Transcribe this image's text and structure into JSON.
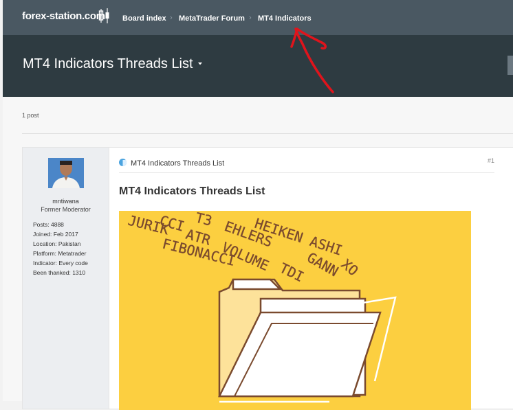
{
  "nav": {
    "logo_text": "forex-station.com",
    "breadcrumbs": [
      "Board index",
      "MetaTrader Forum",
      "MT4 Indicators"
    ]
  },
  "header": {
    "title": "MT4 Indicators Threads List"
  },
  "topic": {
    "post_count": "1 post"
  },
  "post": {
    "author": {
      "username": "mntiwana",
      "rank": "Former Moderator",
      "stats": [
        {
          "label": "Posts:",
          "value": "4888"
        },
        {
          "label": "Joined:",
          "value": "Feb 2017"
        },
        {
          "label": "Location:",
          "value": "Pakistan"
        },
        {
          "label": "Platform:",
          "value": "Metatrader"
        },
        {
          "label": "Indicator:",
          "value": "Every code"
        },
        {
          "label": "Been thanked:",
          "value": "1310"
        }
      ]
    },
    "subject": "MT4 Indicators Threads List",
    "number": "#1",
    "title": "MT4 Indicators Threads List",
    "banner_words": [
      "HEIKEN ASHI",
      "T3",
      "EHLERS",
      "GANN",
      "XO",
      "CCI",
      "ATR",
      "VOLUME",
      "TDI",
      "JURIK",
      "FIBONACCI"
    ]
  },
  "colors": {
    "nav_bg": "#4a5862",
    "header_bg": "#2e3b41",
    "banner_bg": "#fccf40",
    "annotation": "#e0141c"
  }
}
